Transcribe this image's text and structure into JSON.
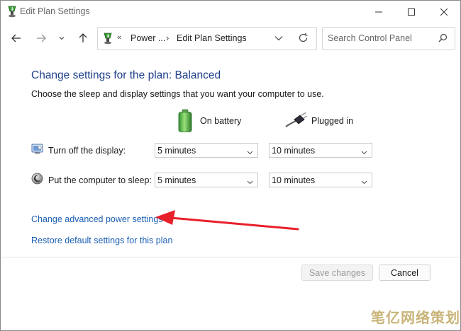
{
  "window": {
    "title": "Edit Plan Settings"
  },
  "address": {
    "overflow_glyph": "«",
    "crumbs": [
      "Power ...",
      "Edit Plan Settings"
    ],
    "separator": "›"
  },
  "search": {
    "placeholder": "Search Control Panel"
  },
  "main": {
    "heading": "Change settings for the plan: Balanced",
    "subtext": "Choose the sleep and display settings that you want your computer to use.",
    "columns": {
      "battery": "On battery",
      "plugged": "Plugged in"
    },
    "rows": [
      {
        "label": "Turn off the display:",
        "battery": "5 minutes",
        "plugged": "10 minutes"
      },
      {
        "label": "Put the computer to sleep:",
        "battery": "5 minutes",
        "plugged": "10 minutes"
      }
    ],
    "links": {
      "advanced": "Change advanced power settings",
      "restore": "Restore default settings for this plan"
    }
  },
  "footer": {
    "save": "Save changes",
    "cancel": "Cancel"
  },
  "annotation": {
    "arrow_color": "#e8202a"
  },
  "watermark": {
    "text": "笔亿网络策划"
  },
  "colors": {
    "heading": "#1e3f8a",
    "link": "#1a5fb4"
  }
}
